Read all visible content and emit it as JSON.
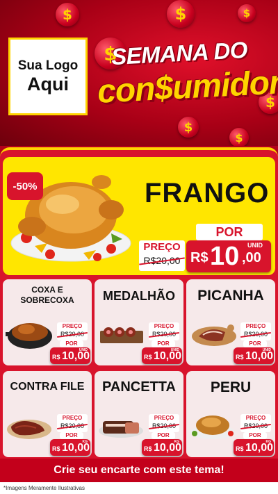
{
  "colors": {
    "primary_red": "#d8142c",
    "yellow": "#ffe600",
    "gold": "#ffd400"
  },
  "header": {
    "logo_line1": "Sua Logo",
    "logo_line2": "Aqui",
    "title_line1": "SEMANA DO",
    "title_line2": "con$umidor",
    "coin_symbol": "$"
  },
  "featured": {
    "discount": "-50%",
    "name": "FRANGO",
    "preco_label": "PREÇO",
    "old_price": "R$20,00",
    "por_label": "POR",
    "unit": "UNID",
    "currency": "R$",
    "new_price_int": "10",
    "new_price_dec": ",00",
    "image_icon": "roast-chicken-icon"
  },
  "products": [
    {
      "name_line1": "COXA E",
      "name_line2": "SOBRECOXA",
      "preco_label": "PREÇO",
      "old_price": "R$20,00",
      "por_label": "POR",
      "unit": "UNID",
      "currency": "R$",
      "price": "10,00",
      "icon": "chicken-pot-icon"
    },
    {
      "name_line1": "MEDALHÃO",
      "name_line2": "",
      "preco_label": "PREÇO",
      "old_price": "R$20,00",
      "por_label": "POR",
      "unit": "UNID",
      "currency": "R$",
      "price": "10,00",
      "icon": "medallion-skewers-icon"
    },
    {
      "name_line1": "PICANHA",
      "name_line2": "",
      "preco_label": "PREÇO",
      "old_price": "R$20,00",
      "por_label": "POR",
      "unit": "UNID",
      "currency": "R$",
      "price": "10,00",
      "icon": "picanha-board-icon"
    },
    {
      "name_line1": "CONTRA FILE",
      "name_line2": "",
      "preco_label": "PREÇO",
      "old_price": "R$20,00",
      "por_label": "POR",
      "unit": "KG",
      "currency": "R$",
      "price": "10,00",
      "icon": "steak-icon"
    },
    {
      "name_line1": "PANCETTA",
      "name_line2": "",
      "preco_label": "PREÇO",
      "old_price": "R$20,00",
      "por_label": "POR",
      "unit": "KG",
      "currency": "R$",
      "price": "10,00",
      "icon": "pancetta-icon"
    },
    {
      "name_line1": "PERU",
      "name_line2": "",
      "preco_label": "PREÇO",
      "old_price": "R$20,00",
      "por_label": "POR",
      "unit": "KG",
      "currency": "R$",
      "price": "10,00",
      "icon": "roast-turkey-icon"
    }
  ],
  "footer": {
    "cta": "Crie seu encarte com este tema!",
    "disclaimer": "*Imagens Meramente Ilustrativas"
  }
}
